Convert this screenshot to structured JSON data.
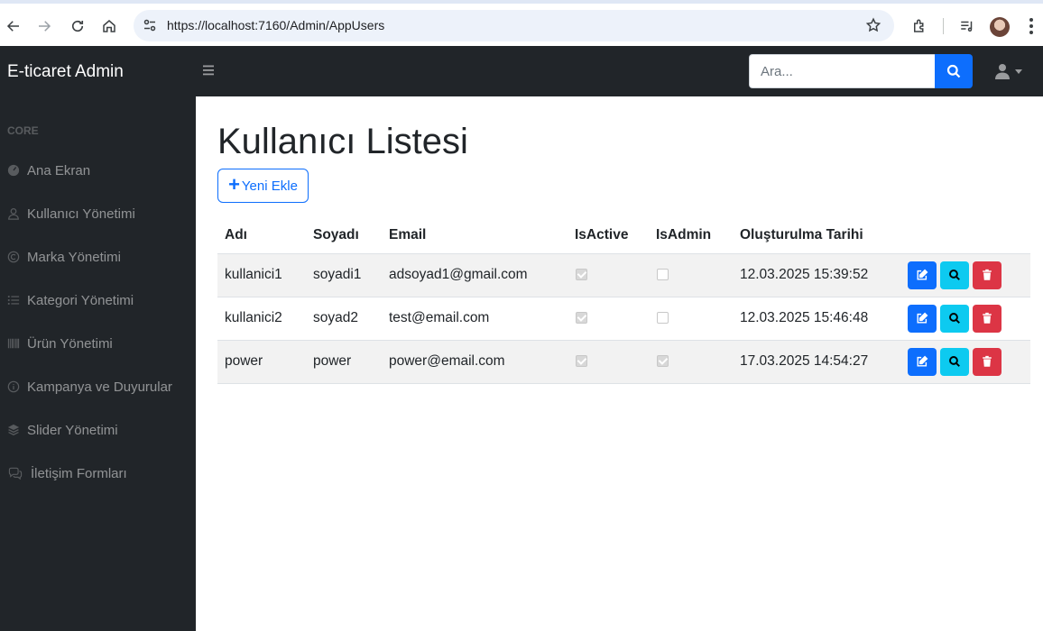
{
  "browser": {
    "url": "https://localhost:7160/Admin/AppUsers"
  },
  "topnav": {
    "brand": "E-ticaret Admin",
    "search_placeholder": "Ara..."
  },
  "sidebar": {
    "heading": "CORE",
    "items": [
      {
        "label": "Ana Ekran",
        "icon": "gauge-icon"
      },
      {
        "label": "Kullanıcı Yönetimi",
        "icon": "user-icon"
      },
      {
        "label": "Marka Yönetimi",
        "icon": "copyright-icon"
      },
      {
        "label": "Kategori Yönetimi",
        "icon": "list-icon"
      },
      {
        "label": "Ürün Yönetimi",
        "icon": "barcode-icon"
      },
      {
        "label": "Kampanya ve Duyurular",
        "icon": "info-icon"
      },
      {
        "label": "Slider Yönetimi",
        "icon": "layers-icon"
      },
      {
        "label": "İletişim Formları",
        "icon": "comments-icon"
      }
    ]
  },
  "main": {
    "title": "Kullanıcı Listesi",
    "add_label": "Yeni Ekle",
    "columns": [
      "Adı",
      "Soyadı",
      "Email",
      "IsActive",
      "IsAdmin",
      "Oluşturulma Tarihi"
    ],
    "rows": [
      {
        "name": "kullanici1",
        "surname": "soyadi1",
        "email": "adsoyad1@gmail.com",
        "is_active": true,
        "is_admin": false,
        "created": "12.03.2025 15:39:52"
      },
      {
        "name": "kullanici2",
        "surname": "soyad2",
        "email": "test@email.com",
        "is_active": true,
        "is_admin": false,
        "created": "12.03.2025 15:46:48"
      },
      {
        "name": "power",
        "surname": "power",
        "email": "power@email.com",
        "is_active": true,
        "is_admin": true,
        "created": "17.03.2025 14:54:27"
      }
    ]
  },
  "colors": {
    "primary": "#0d6efd",
    "info": "#0dcaf0",
    "danger": "#dc3545",
    "dark": "#212529"
  }
}
